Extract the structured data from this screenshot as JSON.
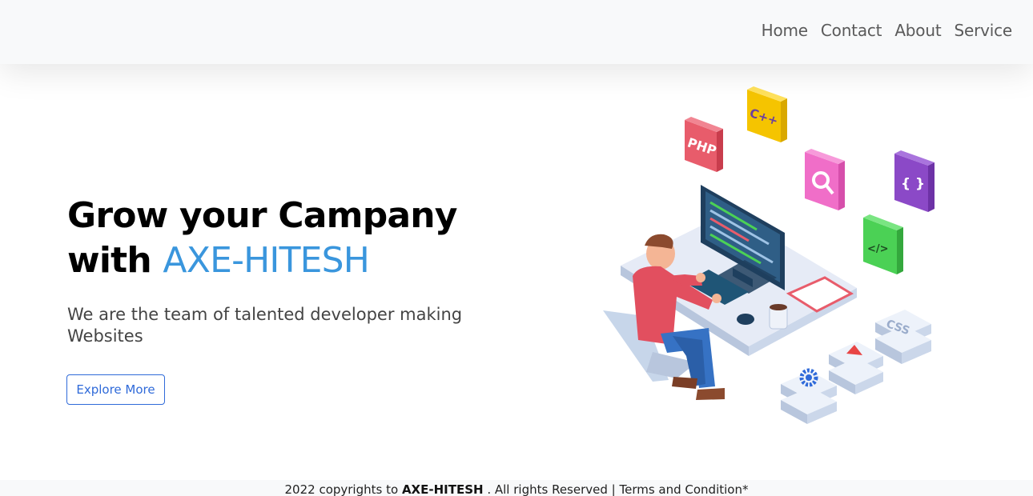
{
  "nav": {
    "items": [
      "Home",
      "Contact",
      "About",
      "Service"
    ]
  },
  "hero": {
    "title_line1": "Grow your Campany",
    "title_with": "with",
    "brand": "AXE-HITESH",
    "subtitle": "We are the team of talented developer making Websites",
    "cta": "Explore More"
  },
  "illustration": {
    "icons": [
      "PHP",
      "C++",
      "{ }",
      "</>",
      "CSS"
    ]
  },
  "footer": {
    "prefix": "2022 copyrights to",
    "brand": "AXE-HITESH",
    "suffix": ". All rights Reserved | Terms and Condition*"
  },
  "colors": {
    "brand": "#3a96dd",
    "button": "#2f6ad9",
    "php": "#e85c6b",
    "cpp": "#f5c400",
    "search": "#f06ec8",
    "braces": "#8b49c7",
    "code": "#4bd155"
  }
}
